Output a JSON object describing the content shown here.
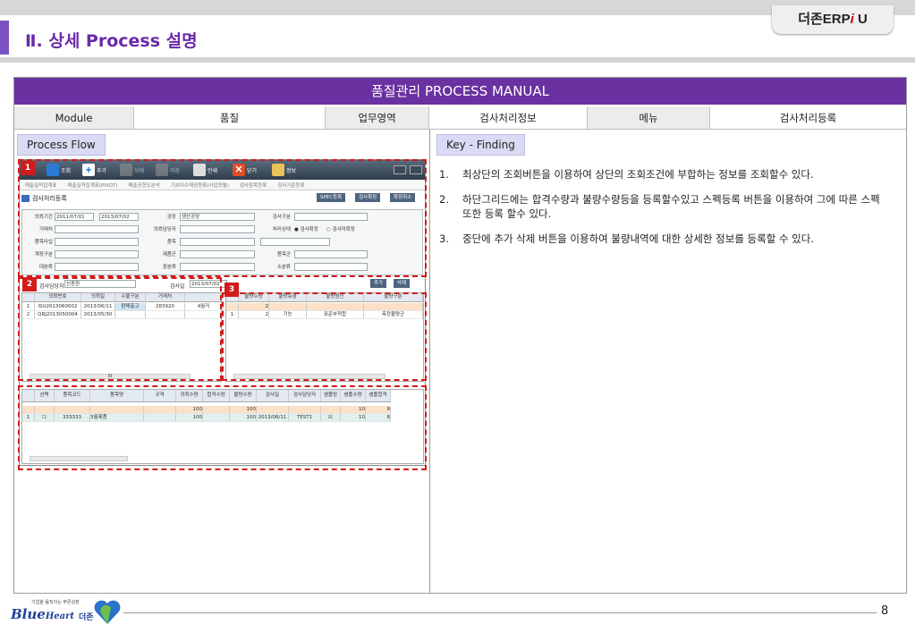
{
  "header": {
    "brand_prefix": "더존ERP",
    "brand_i": "i",
    "brand_suffix": " U",
    "title": "Ⅱ. 상세 Process 설명"
  },
  "banner": "품질관리 PROCESS MANUAL",
  "meta": {
    "module_label": "Module",
    "module_value": "품질",
    "area_label": "업무영역",
    "area_value": "검사처리정보",
    "menu_label": "메뉴",
    "menu_value": "검사처리등록"
  },
  "process_flow_label": "Process Flow",
  "key_finding_label": "Key - Finding",
  "findings": [
    {
      "num": "1.",
      "text": "최상단의 조회버튼을 이용하여 상단의 조회조건에 부합하는 정보를 조회할수 있다."
    },
    {
      "num": "2.",
      "text": "하단그리드에는 합격수량과 불량수량등을 등록할수있고 스펙등록 버튼을 이용하여 그에 따른 스펙 또한 등록 할수 있다."
    },
    {
      "num": "3.",
      "text": "중단에 추가 삭제 버튼을 이용하여 불량내역에 대한 상세한 정보를 등록할 수 있다."
    }
  ],
  "app": {
    "toolbar": {
      "search": "조회",
      "add": "추가",
      "delete": "삭제",
      "save": "저장",
      "print": "인쇄",
      "close": "닫기",
      "info": "정보"
    },
    "menus": [
      "매출실적집계표",
      "매출실적집계표(PIVOT)",
      "매출공헌도분석",
      "기초미수채권등록(사업장별)",
      "검사항목등록",
      "검사기준등록"
    ],
    "screen_title": "검사처리등록",
    "top_buttons": [
      "SPEC등록",
      "검사확정",
      "확정취소"
    ],
    "cond": {
      "req_period_label": "의뢰기간",
      "date_from": "2011/07/01",
      "date_to": "2013/07/02",
      "plant_label": "공장",
      "plant_value": "생산공장",
      "insp_type_label": "검사구분",
      "vendor_label": "거래처",
      "requester_label": "의뢰담당자",
      "status_label": "처리상태",
      "status_opt1": "검사확정",
      "status_opt2": "검사미확정",
      "item_type_label": "품목타입",
      "item_label": "품목",
      "acct_label": "계정구분",
      "prod_group_label": "제품군",
      "item_group_label": "품목군",
      "major_label": "대분류",
      "mid_label": "중분류",
      "minor_label": "소분류"
    },
    "inspector_label": "검사담당자",
    "inspector_value": "신종환",
    "insp_date_label": "검사일",
    "insp_date_value": "2013/07/02",
    "mid_buttons": [
      "추가",
      "삭제"
    ],
    "grid1": {
      "headers": [
        "",
        "의뢰번호",
        "의뢰일",
        "수불구분",
        "거래처",
        ""
      ],
      "rows": [
        [
          "1",
          "ISU2013060002",
          "2013/06/11",
          "판매출고",
          "283920",
          "4월거"
        ],
        [
          "2",
          "QRJ2013050004",
          "2013/05/30",
          "",
          "",
          ""
        ]
      ]
    },
    "grid2": {
      "headers": [
        "",
        "불량수량",
        "불량유형",
        "불량원인",
        "불량구분"
      ],
      "sum_row": [
        "",
        "2",
        "",
        "",
        ""
      ],
      "rows": [
        [
          "1",
          "2",
          "기능",
          "표준부적합",
          "측정불량군"
        ]
      ]
    },
    "grid3": {
      "headers": [
        "",
        "선택",
        "품목코드",
        "품목명",
        "규격",
        "의뢰수량",
        "합격수량",
        "불량수량",
        "검사일",
        "검사담당자",
        "샘플링",
        "샘플수량",
        "샘플합격"
      ],
      "sum_row": [
        "",
        "",
        "",
        "",
        "",
        "100",
        "",
        "100",
        "",
        "",
        "",
        "10",
        "9"
      ],
      "rows": [
        [
          "1",
          "",
          "333333",
          "3월제품",
          "",
          "100",
          "",
          "100",
          "2013/06/11",
          "TEST1",
          "",
          "10",
          "8"
        ]
      ]
    },
    "scroll_mark": "III"
  },
  "badges": [
    "1",
    "2",
    "3"
  ],
  "page_number": "8",
  "logo": {
    "tagline": "기업을 움직이는 푸른심장",
    "name_main": "Blue",
    "name_sub": "Heart",
    "name_kr": "더존"
  },
  "colors": {
    "banner": "#6a31a0",
    "title": "#6a2aa8",
    "highlight": "#d21b1b",
    "tag_bg": "#dadaf4"
  }
}
